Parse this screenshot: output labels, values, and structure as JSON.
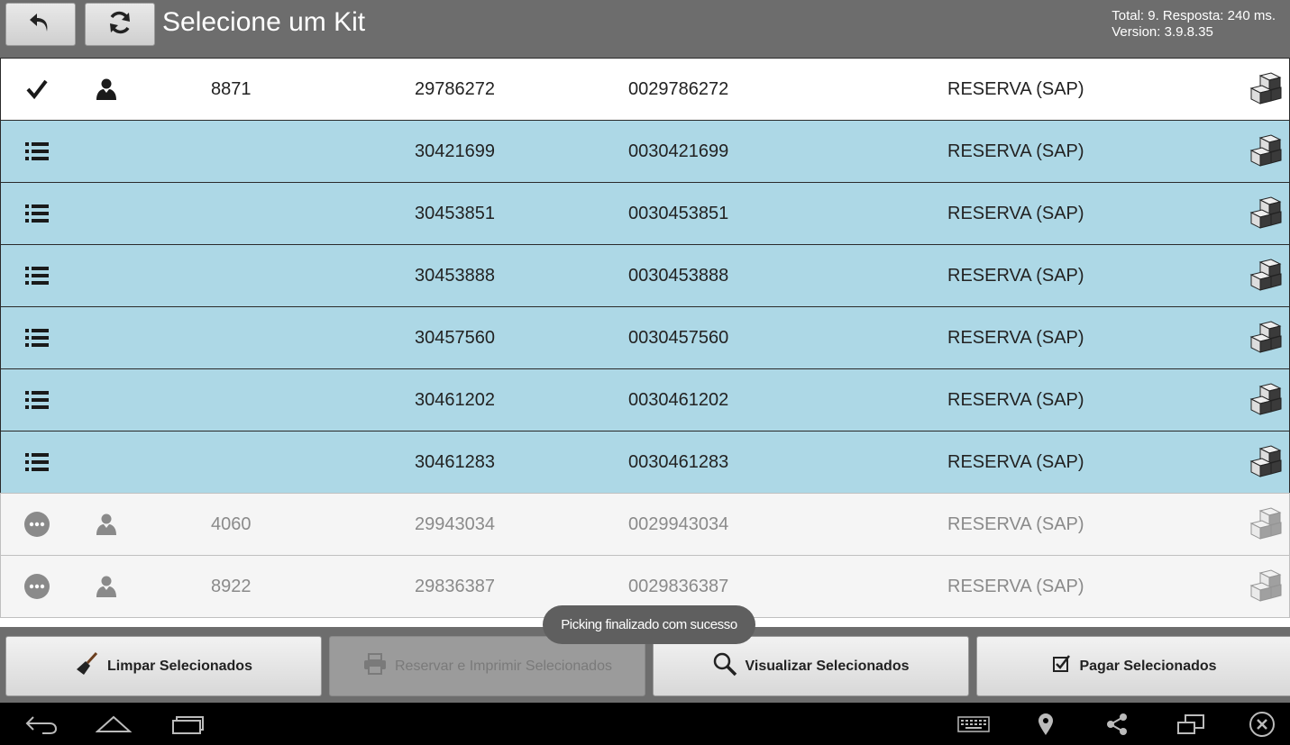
{
  "header": {
    "title": "Selecione um Kit",
    "stats_line1": "Total: 9. Resposta: 240 ms.",
    "stats_line2": "Version: 3.9.8.35",
    "back_icon": "undo-icon",
    "refresh_icon": "refresh-icon"
  },
  "rows": [
    {
      "status": "check",
      "user": true,
      "num": "8871",
      "code": "29786272",
      "code2": "0029786272",
      "type": "RESERVA (SAP)",
      "style": "selected"
    },
    {
      "status": "list",
      "user": false,
      "num": "",
      "code": "30421699",
      "code2": "0030421699",
      "type": "RESERVA (SAP)",
      "style": "blue"
    },
    {
      "status": "list",
      "user": false,
      "num": "",
      "code": "30453851",
      "code2": "0030453851",
      "type": "RESERVA (SAP)",
      "style": "blue"
    },
    {
      "status": "list",
      "user": false,
      "num": "",
      "code": "30453888",
      "code2": "0030453888",
      "type": "RESERVA (SAP)",
      "style": "blue"
    },
    {
      "status": "list",
      "user": false,
      "num": "",
      "code": "30457560",
      "code2": "0030457560",
      "type": "RESERVA (SAP)",
      "style": "blue"
    },
    {
      "status": "list",
      "user": false,
      "num": "",
      "code": "30461202",
      "code2": "0030461202",
      "type": "RESERVA (SAP)",
      "style": "blue"
    },
    {
      "status": "list",
      "user": false,
      "num": "",
      "code": "30461283",
      "code2": "0030461283",
      "type": "RESERVA (SAP)",
      "style": "blue"
    },
    {
      "status": "more",
      "user": true,
      "num": "4060",
      "code": "29943034",
      "code2": "0029943034",
      "type": "RESERVA (SAP)",
      "style": "grey"
    },
    {
      "status": "more",
      "user": true,
      "num": "8922",
      "code": "29836387",
      "code2": "0029836387",
      "type": "RESERVA (SAP)",
      "style": "grey"
    }
  ],
  "toast": "Picking finalizado com sucesso",
  "toolbar": {
    "clear_label": "Limpar Selecionados",
    "reserve_print_label": "Reservar e Imprimir Selecionados",
    "view_label": "Visualizar Selecionados",
    "pay_label": "Pagar Selecionados"
  },
  "colors": {
    "header_bg": "#6d6d6d",
    "row_blue": "#add8e6",
    "row_grey": "#f5f5f5",
    "toast_bg": "#5f5f5f"
  }
}
